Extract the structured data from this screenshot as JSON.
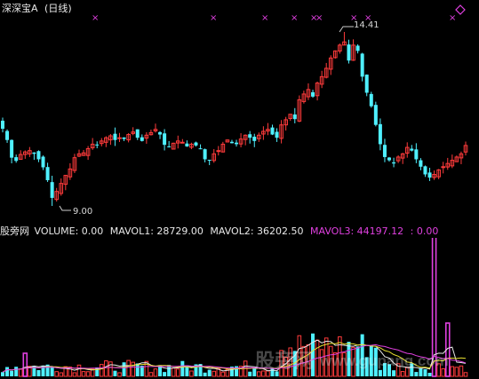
{
  "title": "深深宝A",
  "period": "(日线)",
  "marks": [
    "×",
    "×",
    "×",
    "×",
    "×",
    "×",
    "×",
    "×",
    "×"
  ],
  "price_labels": {
    "high": "14.41",
    "low": "9.00"
  },
  "volume_header": {
    "name": "股旁网",
    "volume": "VOLUME: 0.00",
    "mavol1": "MAVOL1: 28729.00",
    "mavol2": "MAVOL2: 36202.50",
    "mavol3": "MAVOL3: 44197.12",
    "tail": ": 0.00"
  },
  "watermark": {
    "cn": "股旁网",
    "url": "www.gupang.com"
  },
  "colors": {
    "up": "#ff3b3b",
    "down": "#4ff0ff",
    "magenta": "#e040e0",
    "white": "#e8e8e8",
    "mavol1": "#e8e8e8",
    "mavol2": "#e8e030",
    "mavol3": "#e040e0"
  },
  "chart_data": {
    "type": "candlestick",
    "price_high": 14.41,
    "price_low": 9.0,
    "candles_close": [
      11.4,
      11.05,
      10.5,
      10.4,
      10.6,
      10.68,
      10.72,
      10.62,
      10.45,
      10.2,
      9.8,
      9.25,
      9.45,
      9.7,
      9.95,
      10.15,
      10.5,
      10.62,
      10.65,
      10.78,
      10.92,
      10.88,
      11.02,
      11.12,
      11.18,
      11.05,
      11.12,
      11.08,
      11.22,
      11.3,
      11.12,
      11.02,
      11.2,
      11.28,
      11.38,
      11.22,
      10.9,
      10.85,
      10.95,
      11.02,
      10.98,
      10.85,
      10.92,
      10.88,
      10.78,
      10.45,
      10.42,
      10.62,
      10.72,
      10.92,
      11.05,
      10.95,
      10.92,
      11.08,
      11.2,
      11.12,
      11.02,
      11.2,
      11.32,
      11.38,
      11.22,
      11.12,
      11.52,
      11.68,
      11.85,
      11.7,
      12.3,
      12.48,
      12.62,
      12.4,
      12.82,
      13.02,
      13.28,
      13.6,
      13.82,
      14.0,
      14.1,
      13.52,
      14.0,
      13.82,
      13.02,
      12.52,
      12.1,
      11.52,
      10.92,
      10.52,
      10.42,
      10.32,
      10.52,
      10.62,
      10.82,
      10.72,
      10.45,
      10.22,
      9.98,
      9.88,
      9.98,
      10.12,
      10.22,
      10.32,
      10.42,
      10.52,
      10.62,
      10.88
    ],
    "volume_magenta_spikes": [
      {
        "index": 5,
        "value": 26
      },
      {
        "index": 96,
        "value": 158
      },
      {
        "index": 99,
        "value": 60
      },
      {
        "index": 104,
        "value": 16
      },
      {
        "index": 105,
        "value": 38
      }
    ]
  }
}
